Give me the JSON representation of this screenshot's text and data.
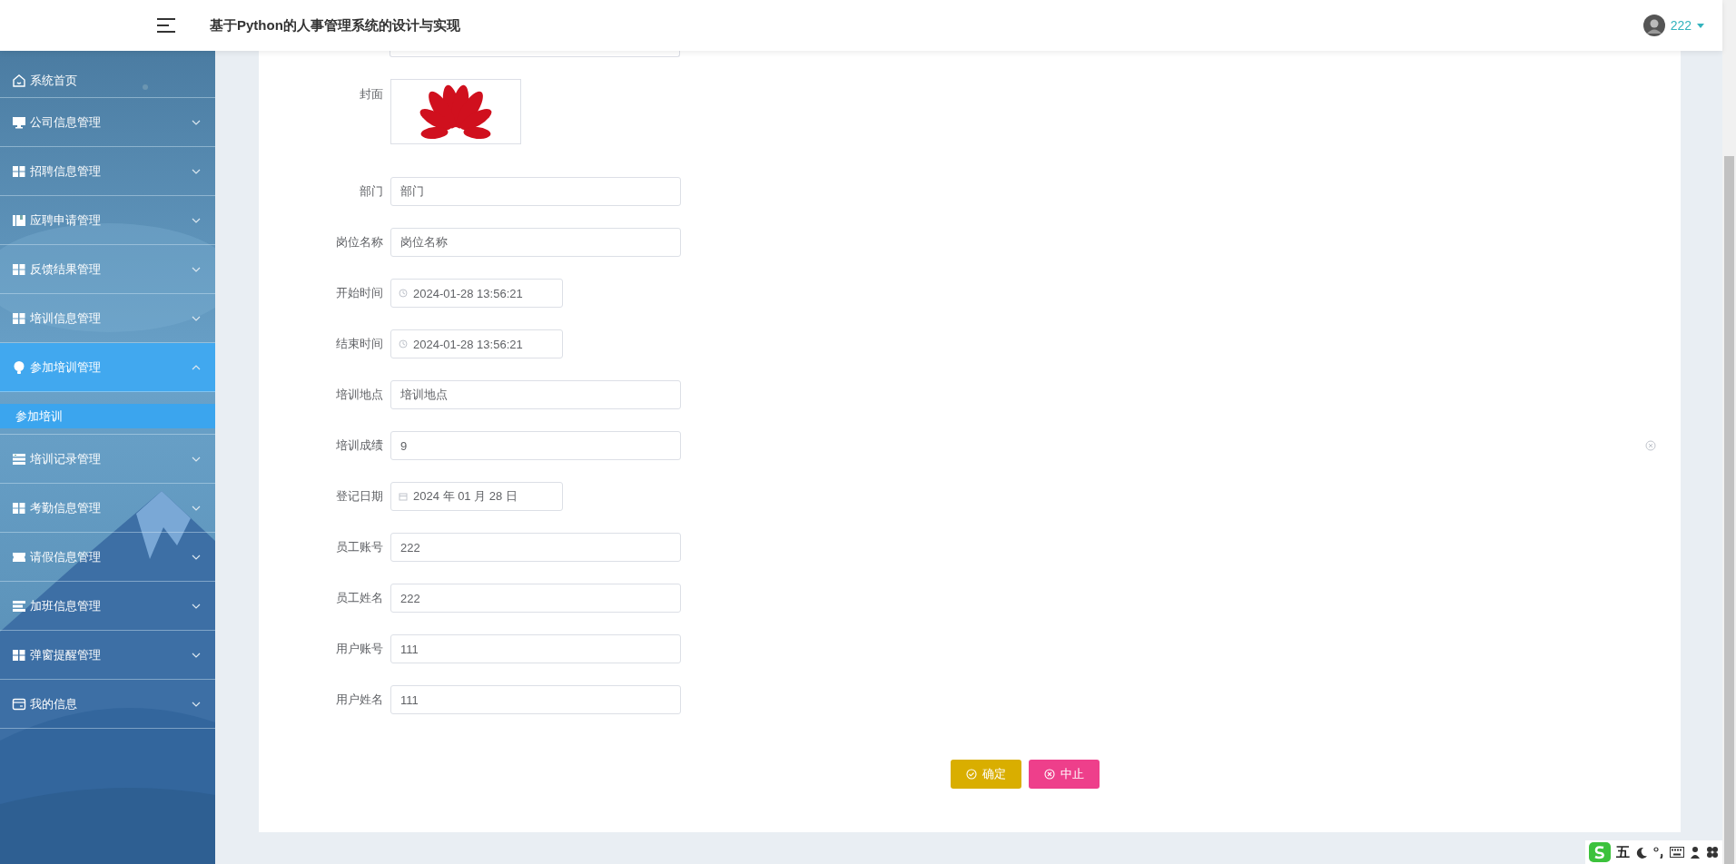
{
  "header": {
    "title": "基于Python的人事管理系统的设计与实现",
    "user": {
      "name": "222"
    }
  },
  "sidebar": {
    "items": [
      {
        "label": "系统首页",
        "kind": "link",
        "selected": false
      },
      {
        "label": "公司信息管理",
        "kind": "group",
        "expanded": false,
        "selected": false
      },
      {
        "label": "招聘信息管理",
        "kind": "group",
        "expanded": false,
        "selected": false
      },
      {
        "label": "应聘申请管理",
        "kind": "group",
        "expanded": false,
        "selected": false
      },
      {
        "label": "反馈结果管理",
        "kind": "group",
        "expanded": false,
        "selected": false
      },
      {
        "label": "培训信息管理",
        "kind": "group",
        "expanded": false,
        "selected": false
      },
      {
        "label": "参加培训管理",
        "kind": "group",
        "expanded": true,
        "selected": true,
        "children": [
          {
            "label": "参加培训",
            "selected": true
          }
        ]
      },
      {
        "label": "培训记录管理",
        "kind": "group",
        "expanded": false,
        "selected": false
      },
      {
        "label": "考勤信息管理",
        "kind": "group",
        "expanded": false,
        "selected": false
      },
      {
        "label": "请假信息管理",
        "kind": "group",
        "expanded": false,
        "selected": false
      },
      {
        "label": "加班信息管理",
        "kind": "group",
        "expanded": false,
        "selected": false
      },
      {
        "label": "弹窗提醒管理",
        "kind": "group",
        "expanded": false,
        "selected": false
      },
      {
        "label": "我的信息",
        "kind": "group",
        "expanded": false,
        "selected": false
      }
    ]
  },
  "form": {
    "fields": [
      {
        "label": "封面"
      },
      {
        "label": "部门",
        "kind": "text",
        "value": "部门"
      },
      {
        "label": "岗位名称",
        "kind": "text",
        "value": "岗位名称"
      },
      {
        "label": "开始时间",
        "kind": "datetime",
        "value": "2024-01-28 13:56:21"
      },
      {
        "label": "结束时间",
        "kind": "datetime",
        "value": "2024-01-28 13:56:21"
      },
      {
        "label": "培训地点",
        "kind": "text",
        "value": "培训地点"
      },
      {
        "label": "培训成绩",
        "kind": "text",
        "value": "9",
        "clearable": true
      },
      {
        "label": "登记日期",
        "kind": "date",
        "value": "2024 年 01 月 28 日"
      },
      {
        "label": "员工账号",
        "kind": "text",
        "value": "222"
      },
      {
        "label": "员工姓名",
        "kind": "text",
        "value": "222"
      },
      {
        "label": "用户账号",
        "kind": "text",
        "value": "111"
      },
      {
        "label": "用户姓名",
        "kind": "text",
        "value": "111"
      }
    ],
    "buttons": [
      {
        "label": "确定",
        "kind": "confirm"
      },
      {
        "label": "中止",
        "kind": "cancel"
      }
    ]
  },
  "ime_toolbar": {
    "mode": "五"
  }
}
